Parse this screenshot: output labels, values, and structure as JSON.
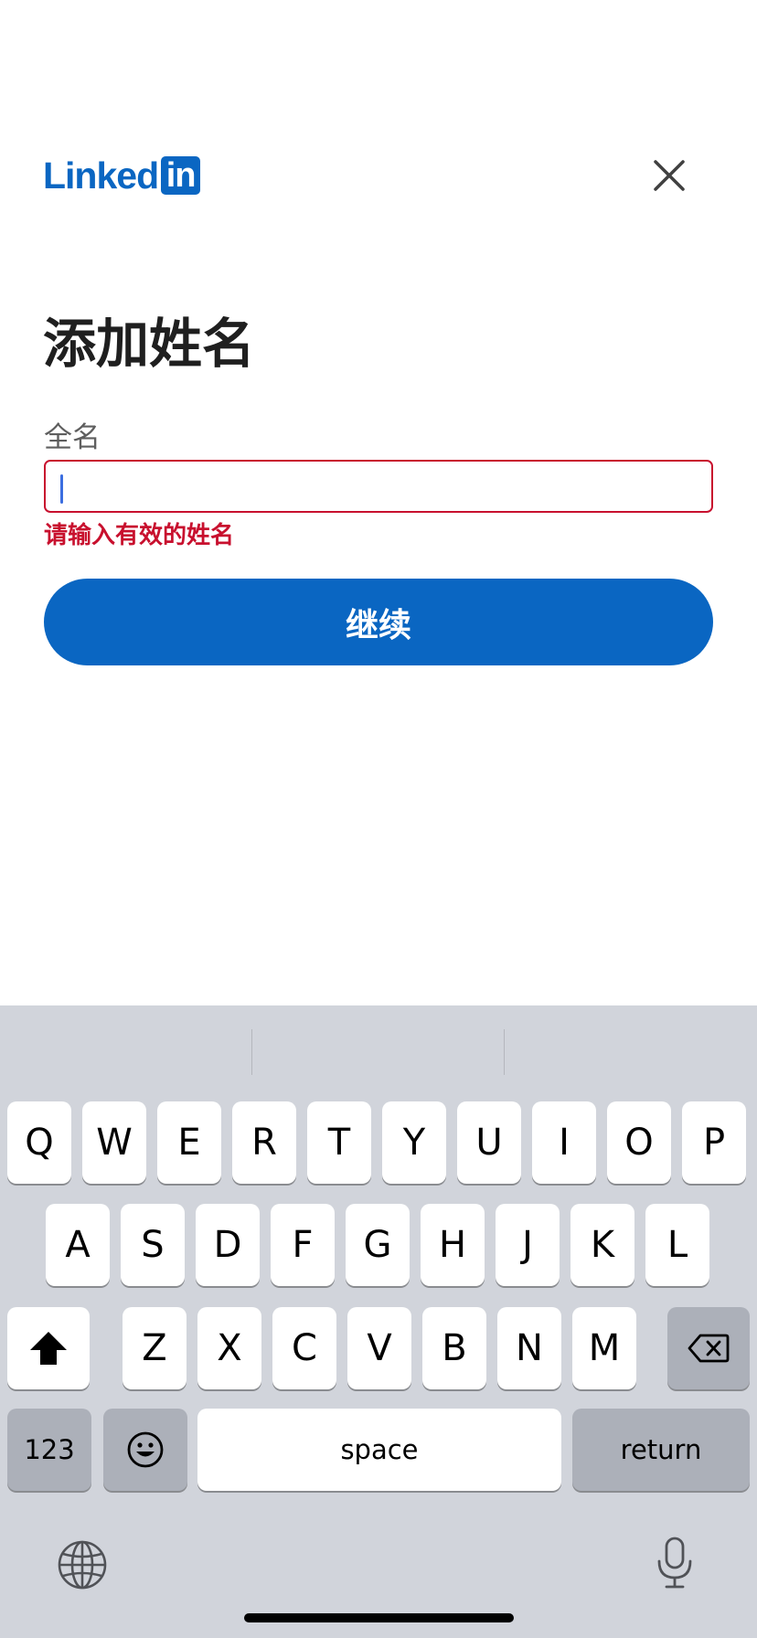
{
  "colors": {
    "brand_blue": "#0a66c2",
    "error_red": "#c8102e",
    "text_dark": "#1f1f1f",
    "label_gray": "#5e5e5e",
    "keyboard_bg": "#d1d4db",
    "caret_blue": "#3c6ee0"
  },
  "header": {
    "logo_word": "Linked",
    "logo_box": "in",
    "close_icon": "close-icon"
  },
  "form": {
    "title": "添加姓名",
    "field_label": "全名",
    "input_value": "",
    "error_message": "请输入有效的姓名",
    "continue_label": "继续"
  },
  "keyboard": {
    "row1": [
      "Q",
      "W",
      "E",
      "R",
      "T",
      "Y",
      "U",
      "I",
      "O",
      "P"
    ],
    "row2": [
      "A",
      "S",
      "D",
      "F",
      "G",
      "H",
      "J",
      "K",
      "L"
    ],
    "row3": [
      "Z",
      "X",
      "C",
      "V",
      "B",
      "N",
      "M"
    ],
    "shift_icon": "shift-icon",
    "backspace_icon": "backspace-icon",
    "numbers_label": "123",
    "emoji_icon": "emoji-icon",
    "space_label": "space",
    "return_label": "return",
    "globe_icon": "globe-icon",
    "mic_icon": "microphone-icon"
  }
}
